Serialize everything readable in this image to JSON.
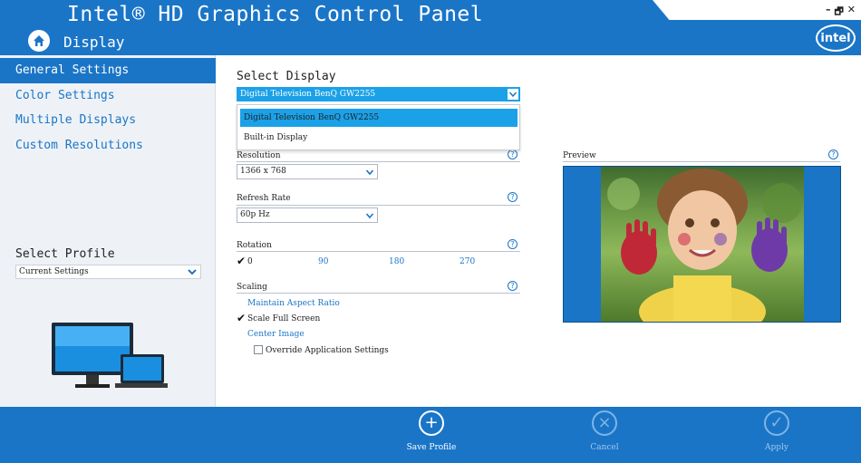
{
  "header": {
    "app_title": "Intel® HD Graphics Control Panel",
    "page_name": "Display",
    "logo_text": "intel",
    "window_controls": {
      "minimize": "–",
      "restore": "🗗",
      "close": "✕"
    }
  },
  "sidebar": {
    "items": [
      {
        "label": "General Settings",
        "active": true
      },
      {
        "label": "Color Settings"
      },
      {
        "label": "Multiple Displays"
      },
      {
        "label": "Custom Resolutions"
      }
    ],
    "profile_label": "Select Profile",
    "profile_value": "Current Settings"
  },
  "main": {
    "select_display_label": "Select Display",
    "select_display_value": "Digital Television BenQ GW2255",
    "display_options": [
      "Digital Television BenQ GW2255",
      "Built-in Display"
    ],
    "resolution_label": "Resolution",
    "resolution_value": "1366 x 768",
    "refresh_label": "Refresh Rate",
    "refresh_value": "60p Hz",
    "rotation_label": "Rotation",
    "rotation_options": [
      "0",
      "90",
      "180",
      "270"
    ],
    "scaling_label": "Scaling",
    "scaling_options": [
      "Maintain Aspect Ratio",
      "Scale Full Screen",
      "Center Image"
    ],
    "override_label": "Override Application Settings",
    "preview_label": "Preview",
    "help_glyph": "?"
  },
  "footer": {
    "save_label": "Save Profile",
    "cancel_label": "Cancel",
    "apply_label": "Apply"
  },
  "colors": {
    "brand_blue": "#1a75c7",
    "highlight_blue": "#1ba1e8",
    "sidebar_bg": "#eef2f6"
  }
}
